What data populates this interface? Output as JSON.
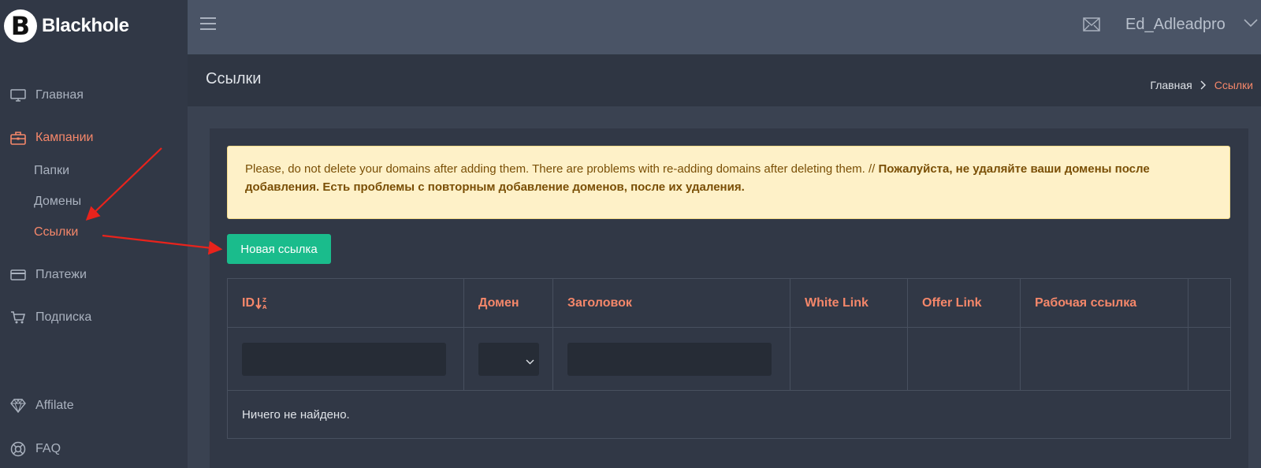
{
  "brand": {
    "logo_letter": "B",
    "name": "Blackhole"
  },
  "sidebar": {
    "items": [
      {
        "label": "Главная",
        "icon": "monitor-icon"
      },
      {
        "label": "Кампании",
        "icon": "briefcase-icon",
        "active": true
      },
      {
        "label": "Папки"
      },
      {
        "label": "Домены"
      },
      {
        "label": "Ссылки",
        "active": true
      },
      {
        "label": "Платежи",
        "icon": "credit-card-icon"
      },
      {
        "label": "Подписка",
        "icon": "cart-icon"
      },
      {
        "label": "Affilate",
        "icon": "diamond-icon"
      },
      {
        "label": "FAQ",
        "icon": "lifebuoy-icon"
      }
    ]
  },
  "header": {
    "user_name": "Ed_Adleadpro",
    "mail_icon": "mail-icon",
    "menu_icon": "hamburger-icon"
  },
  "page": {
    "title": "Ссылки",
    "breadcrumb": {
      "home": "Главная",
      "current": "Ссылки"
    }
  },
  "alert": {
    "text_en": "Please, do not delete your domains after adding them. There are problems with re-adding domains after deleting them. //",
    "text_ru": "Пожалуйста, не удаляйте ваши домены после добавления. Есть проблемы с повторным добавление доменов, после их удаления."
  },
  "actions": {
    "new_link": "Новая ссылка"
  },
  "table": {
    "columns": [
      "ID",
      "Домен",
      "Заголовок",
      "White Link",
      "Offer Link",
      "Рабочая ссылка"
    ],
    "empty_text": "Ничего не найдено."
  },
  "colors": {
    "accent": "#f5876a",
    "success": "#1abc8c",
    "annotation": "#e8231c"
  }
}
